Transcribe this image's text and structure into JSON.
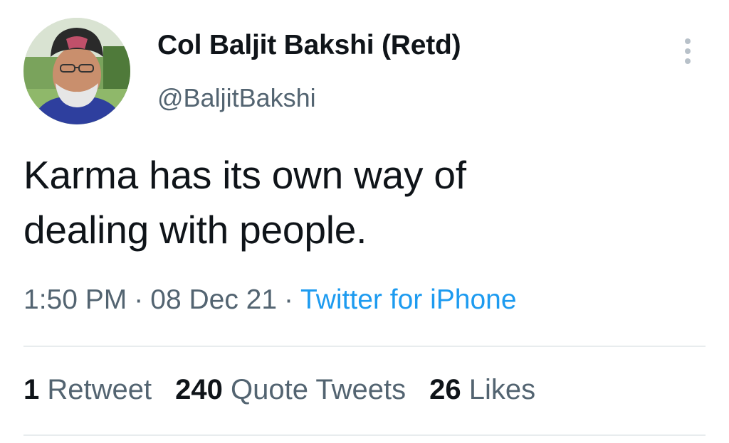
{
  "tweet": {
    "author": {
      "display_name": "Col Baljit Bakshi (Retd)",
      "handle": "@BaljitBakshi",
      "avatar_icon": "profile-photo"
    },
    "text_line1": "Karma has its own way of",
    "text_line2": "dealing with people.",
    "time": "1:50 PM",
    "date": "08 Dec 21",
    "separator": "·",
    "source": "Twitter for iPhone",
    "stats": {
      "retweets_count": "1",
      "retweets_label": "Retweet",
      "quotes_count": "240",
      "quotes_label": "Quote Tweets",
      "likes_count": "26",
      "likes_label": "Likes"
    },
    "more_icon": "more-vertical-icon"
  },
  "colors": {
    "text_primary": "#0f1419",
    "text_secondary": "#536471",
    "link": "#1d9bf0",
    "divider": "#e8ecee"
  }
}
